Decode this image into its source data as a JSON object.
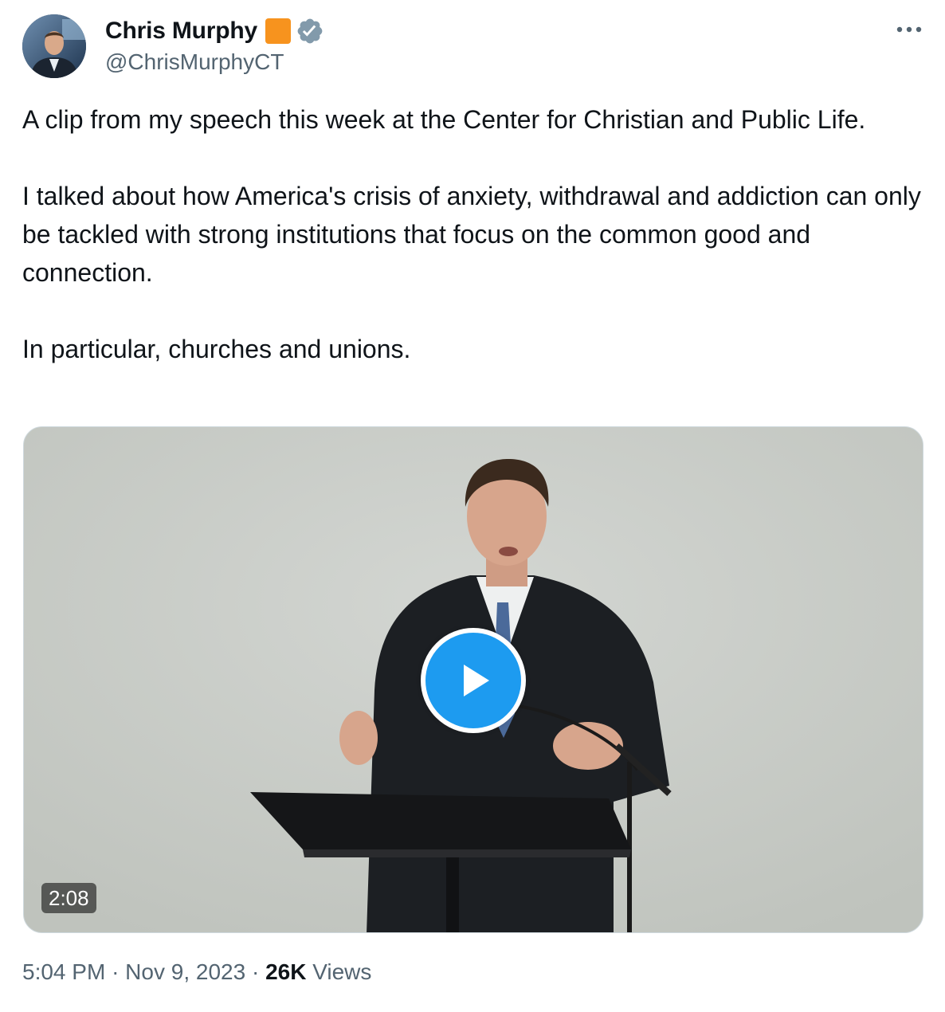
{
  "author": {
    "display_name": "Chris Murphy",
    "handle": "@ChrisMurphyCT",
    "affiliation_badge_color": "#f7931e",
    "verified_badge_color": "#829aab"
  },
  "icons": {
    "avatar": "avatar",
    "affiliation": "affiliation-badge-icon",
    "verified": "verified-badge-icon",
    "more": "more-icon",
    "play": "play-icon"
  },
  "tweet": {
    "paragraphs": [
      "A clip from my speech this week at the Center for Christian and Public Life.",
      "I talked about how America's crisis of anxiety, withdrawal and addiction can only be tackled with strong institutions that focus on the common good and connection.",
      "In particular, churches and unions."
    ]
  },
  "media": {
    "type": "video",
    "duration": "2:08",
    "play_button_color": "#1d9bf0"
  },
  "meta": {
    "time": "5:04 PM",
    "separator": "·",
    "date": "Nov 9, 2023",
    "views_count": "26K",
    "views_label": "Views"
  }
}
